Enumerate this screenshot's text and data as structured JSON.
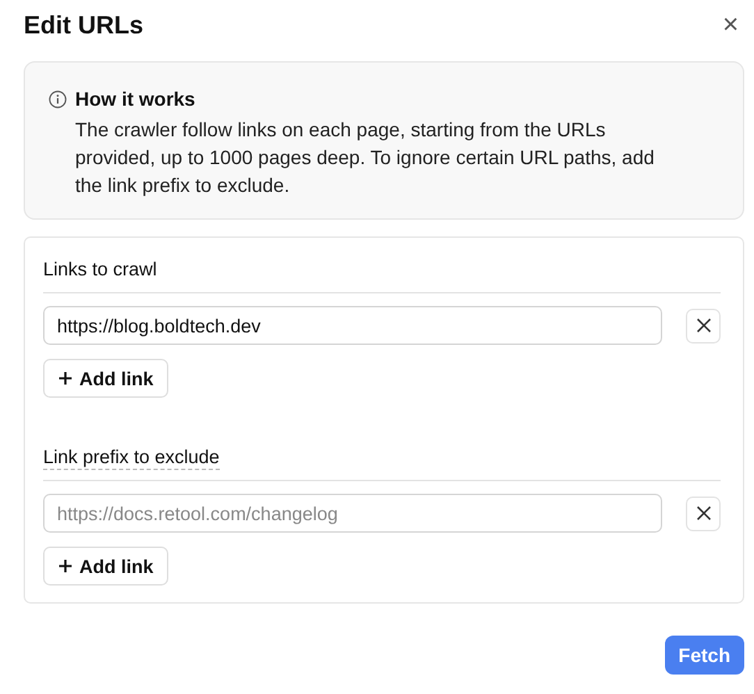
{
  "dialog": {
    "title": "Edit URLs",
    "close": "×"
  },
  "info": {
    "title": "How it works",
    "text": "The crawler follow links on each page, starting from the URLs provided, up to 1000 pages deep. To ignore certain URL paths, add the link prefix to exclude."
  },
  "sections": [
    {
      "label": "Links to crawl",
      "has_tooltip": false,
      "links": [
        {
          "value": "https://blog.boldtech.dev"
        }
      ],
      "add_button": "Add link"
    },
    {
      "label": "Link prefix to exclude",
      "has_tooltip": true,
      "links": [
        {
          "placeholder": "https://docs.retool.com/changelog"
        }
      ],
      "add_button": "Add link"
    }
  ],
  "primary_button": "Fetch"
}
